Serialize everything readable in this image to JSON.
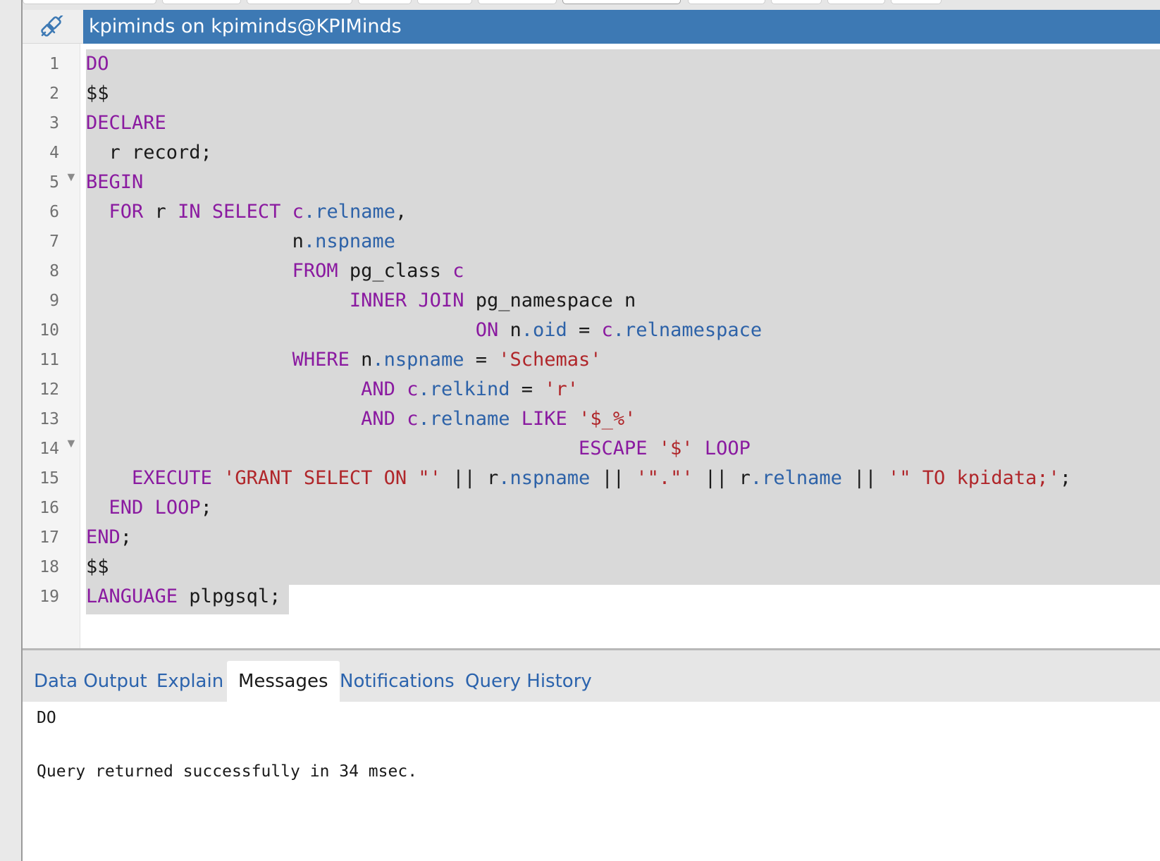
{
  "title_bar": {
    "connection_label": "kpiminds on kpiminds@KPIMinds",
    "connection_icon": "plug-link-icon"
  },
  "editor": {
    "language": "plpgsql",
    "fold_markers_lines": [
      5,
      14
    ],
    "lines": [
      {
        "n": "1"
      },
      {
        "n": "2"
      },
      {
        "n": "3"
      },
      {
        "n": "4"
      },
      {
        "n": "5"
      },
      {
        "n": "6"
      },
      {
        "n": "7"
      },
      {
        "n": "8"
      },
      {
        "n": "9"
      },
      {
        "n": "10"
      },
      {
        "n": "11"
      },
      {
        "n": "12"
      },
      {
        "n": "13"
      },
      {
        "n": "14"
      },
      {
        "n": "15"
      },
      {
        "n": "16"
      },
      {
        "n": "17"
      },
      {
        "n": "18"
      },
      {
        "n": "19"
      }
    ],
    "tokens": {
      "l1": [
        "DO"
      ],
      "l2": [
        "$$"
      ],
      "l3": [
        "DECLARE"
      ],
      "l4": [
        "  r record;"
      ],
      "l5": [
        "BEGIN"
      ],
      "l6": [
        "  ",
        "FOR",
        " r ",
        "IN",
        " ",
        "SELECT",
        " ",
        "c",
        ".relname",
        ","
      ],
      "l7": [
        "                  n",
        ".nspname"
      ],
      "l8": [
        "                  ",
        "FROM",
        " pg_class ",
        "c"
      ],
      "l9": [
        "                       ",
        "INNER",
        " ",
        "JOIN",
        " pg_namespace n"
      ],
      "l10": [
        "                                  ",
        "ON",
        " n",
        ".oid",
        " = ",
        "c",
        ".relnamespace"
      ],
      "l11": [
        "                  ",
        "WHERE",
        " n",
        ".nspname",
        " = ",
        "'Schemas'"
      ],
      "l12": [
        "                        ",
        "AND",
        " ",
        "c",
        ".relkind",
        " = ",
        "'r'"
      ],
      "l13": [
        "                        ",
        "AND",
        " ",
        "c",
        ".relname",
        " ",
        "LIKE",
        " ",
        "'$_%'"
      ],
      "l14": [
        "                                           ",
        "ESCAPE",
        " ",
        "'$'",
        " ",
        "LOOP"
      ],
      "l15": [
        "    ",
        "EXECUTE",
        " ",
        "'GRANT SELECT ON \"'",
        " || r",
        ".nspname",
        " || ",
        "'\".\"'",
        " || r",
        ".relname",
        " || ",
        "'\" TO kpidata;'",
        ";"
      ],
      "l16": [
        "  ",
        "END",
        " ",
        "LOOP",
        ";"
      ],
      "l17": [
        "END",
        ";"
      ],
      "l18": [
        "$$"
      ],
      "l19": [
        "LANGUAGE",
        " plpgsql;"
      ]
    }
  },
  "result_tabs": [
    {
      "label": "Data Output",
      "active": false
    },
    {
      "label": "Explain",
      "active": false
    },
    {
      "label": "Messages",
      "active": true
    },
    {
      "label": "Notifications",
      "active": false
    },
    {
      "label": "Query History",
      "active": false
    }
  ],
  "messages": {
    "line1": "DO",
    "line2": "Query returned successfully in 34 msec."
  },
  "colors": {
    "title_bar_bg": "#3d79b4",
    "keyword": "#8a1aa0",
    "property": "#2d62a8",
    "string": "#b0262a",
    "selection": "#d9d9d9",
    "tab_link": "#2b63ad"
  }
}
